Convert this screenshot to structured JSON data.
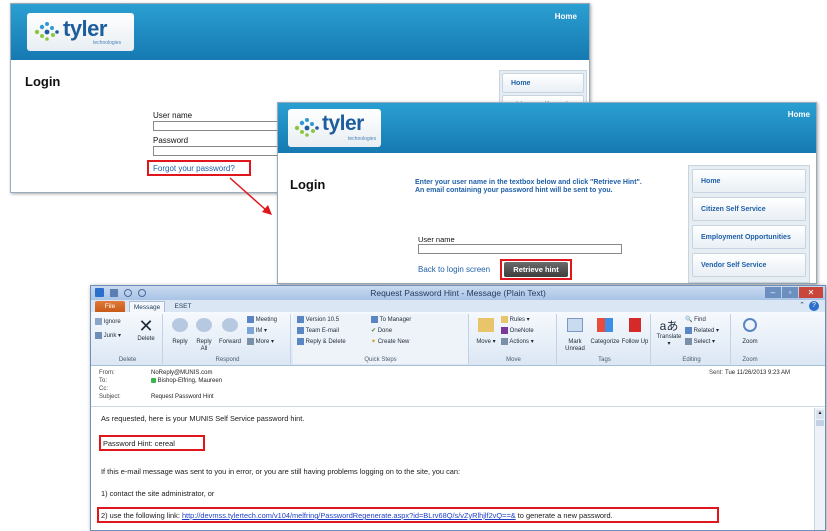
{
  "portal_back": {
    "brand": "tyler",
    "brand_sub": "technologies",
    "nav_home": "Home",
    "page_title": "Login",
    "username_label": "User name",
    "password_label": "Password",
    "forgot_link": "Forgot your password?",
    "sidebar": [
      "Home",
      "Citizen Self Service"
    ]
  },
  "portal_front": {
    "brand": "tyler",
    "brand_sub": "technologies",
    "nav_home": "Home",
    "page_title": "Login",
    "instructions": "Enter your user name in the textbox below and click \"Retrieve Hint\". An email containing your password hint will be sent to you.",
    "username_label": "User name",
    "back_link": "Back to login screen",
    "retrieve_button": "Retrieve hint",
    "sidebar": [
      "Home",
      "Citizen Self Service",
      "Employment Opportunities",
      "Vendor Self Service"
    ]
  },
  "outlook": {
    "title": "Request Password Hint  -  Message (Plain Text)",
    "tabs": [
      "File",
      "Message",
      "ESET"
    ],
    "ribbon": {
      "delete_group": {
        "label": "Delete",
        "ignore": "Ignore",
        "junk": "Junk",
        "delete": "Delete"
      },
      "respond_group": {
        "label": "Respond",
        "reply": "Reply",
        "reply_all": "Reply All",
        "forward": "Forward",
        "meeting": "Meeting",
        "im": "IM",
        "more": "More"
      },
      "quicksteps_group": {
        "label": "Quick Steps",
        "items": [
          "Version 10.5",
          "Team E-mail",
          "Reply & Delete",
          "To Manager",
          "Done",
          "Create New"
        ]
      },
      "move_group": {
        "label": "Move",
        "move": "Move",
        "rules": "Rules",
        "onenote": "OneNote",
        "actions": "Actions"
      },
      "tags_group": {
        "label": "Tags",
        "mark_unread": "Mark Unread",
        "categorize": "Categorize",
        "follow_up": "Follow Up"
      },
      "editing_group": {
        "label": "Editing",
        "translate": "Translate",
        "find": "Find",
        "related": "Related",
        "select": "Select"
      },
      "zoom_group": {
        "label": "Zoom",
        "zoom": "Zoom"
      }
    },
    "header": {
      "from_label": "From:",
      "from_value": "NoReply@MUNIS.com",
      "to_label": "To:",
      "to_value": "Bishop-Elfring, Maureen",
      "cc_label": "Cc:",
      "subject_label": "Subject:",
      "subject_value": "Request Password Hint",
      "sent_label": "Sent:",
      "sent_value": "Tue 11/26/2013 9:23 AM"
    },
    "body": {
      "line1": "As requested, here is your MUNIS Self Service password hint.",
      "hint": "Password Hint: cereal",
      "line3": "If this e-mail message was sent to you in error, or you are still having problems logging on to the site, you can:",
      "line4": "1) contact the site administrator, or",
      "line5_prefix": "2) use the following link: ",
      "line5_link": "http://devmss.tylertech.com/v104/melfring/PasswordRegenerate.aspx?id=BLrv68Q/s/vZyRlhjlf2vQ==&",
      "line5_suffix": " to generate a new password."
    }
  },
  "colors": {
    "banner": "#1f8cc6",
    "highlight_red": "#e0161c",
    "link_blue": "#1f5fa8",
    "file_tab": "#d2651f"
  }
}
